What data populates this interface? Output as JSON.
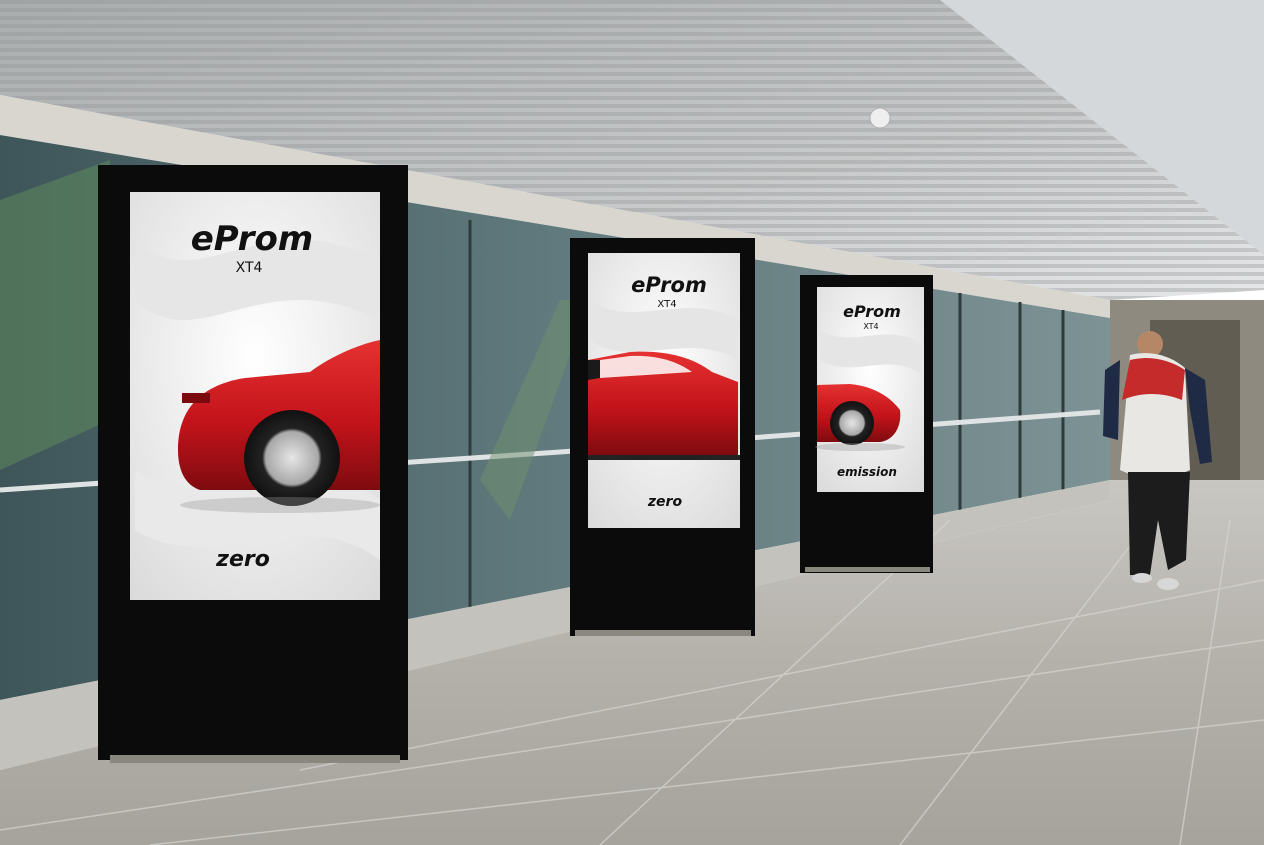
{
  "scene": {
    "description_free": true
  },
  "kiosks": [
    {
      "brand": "eProm",
      "model": "XT4",
      "tagline": "zero"
    },
    {
      "brand": "eProm",
      "model": "XT4",
      "tagline": "zero"
    },
    {
      "brand": "eProm",
      "model": "XT4",
      "tagline": "emission"
    }
  ],
  "colors": {
    "car_red": "#c8141a",
    "kiosk_frame": "#0b0b0b",
    "poster_bg": "#f2f2f2",
    "ceiling": "#b9bcbf",
    "floor": "#b9b7b3",
    "glass": "#4f6469",
    "jacket_red": "#c42b2a",
    "jacket_white": "#e9e7e3"
  }
}
